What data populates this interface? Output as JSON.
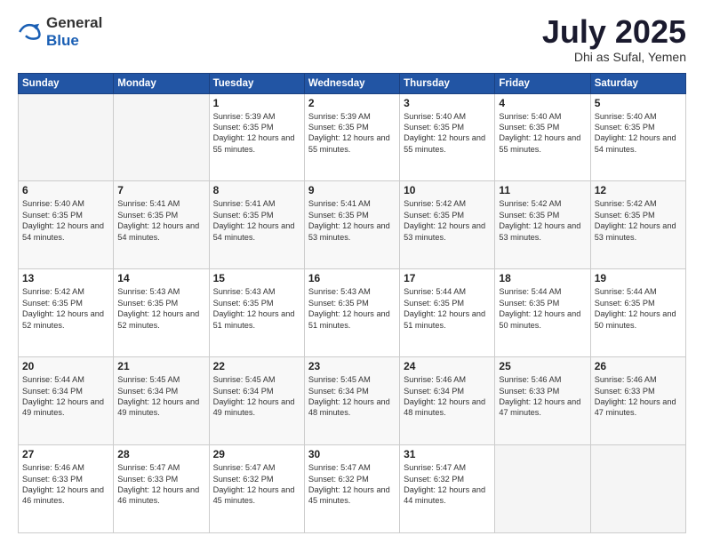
{
  "header": {
    "logo_general": "General",
    "logo_blue": "Blue",
    "month_year": "July 2025",
    "location": "Dhi as Sufal, Yemen"
  },
  "weekdays": [
    "Sunday",
    "Monday",
    "Tuesday",
    "Wednesday",
    "Thursday",
    "Friday",
    "Saturday"
  ],
  "weeks": [
    [
      {
        "day": "",
        "content": ""
      },
      {
        "day": "",
        "content": ""
      },
      {
        "day": "1",
        "content": "Sunrise: 5:39 AM\nSunset: 6:35 PM\nDaylight: 12 hours and 55 minutes."
      },
      {
        "day": "2",
        "content": "Sunrise: 5:39 AM\nSunset: 6:35 PM\nDaylight: 12 hours and 55 minutes."
      },
      {
        "day": "3",
        "content": "Sunrise: 5:40 AM\nSunset: 6:35 PM\nDaylight: 12 hours and 55 minutes."
      },
      {
        "day": "4",
        "content": "Sunrise: 5:40 AM\nSunset: 6:35 PM\nDaylight: 12 hours and 55 minutes."
      },
      {
        "day": "5",
        "content": "Sunrise: 5:40 AM\nSunset: 6:35 PM\nDaylight: 12 hours and 54 minutes."
      }
    ],
    [
      {
        "day": "6",
        "content": "Sunrise: 5:40 AM\nSunset: 6:35 PM\nDaylight: 12 hours and 54 minutes."
      },
      {
        "day": "7",
        "content": "Sunrise: 5:41 AM\nSunset: 6:35 PM\nDaylight: 12 hours and 54 minutes."
      },
      {
        "day": "8",
        "content": "Sunrise: 5:41 AM\nSunset: 6:35 PM\nDaylight: 12 hours and 54 minutes."
      },
      {
        "day": "9",
        "content": "Sunrise: 5:41 AM\nSunset: 6:35 PM\nDaylight: 12 hours and 53 minutes."
      },
      {
        "day": "10",
        "content": "Sunrise: 5:42 AM\nSunset: 6:35 PM\nDaylight: 12 hours and 53 minutes."
      },
      {
        "day": "11",
        "content": "Sunrise: 5:42 AM\nSunset: 6:35 PM\nDaylight: 12 hours and 53 minutes."
      },
      {
        "day": "12",
        "content": "Sunrise: 5:42 AM\nSunset: 6:35 PM\nDaylight: 12 hours and 53 minutes."
      }
    ],
    [
      {
        "day": "13",
        "content": "Sunrise: 5:42 AM\nSunset: 6:35 PM\nDaylight: 12 hours and 52 minutes."
      },
      {
        "day": "14",
        "content": "Sunrise: 5:43 AM\nSunset: 6:35 PM\nDaylight: 12 hours and 52 minutes."
      },
      {
        "day": "15",
        "content": "Sunrise: 5:43 AM\nSunset: 6:35 PM\nDaylight: 12 hours and 51 minutes."
      },
      {
        "day": "16",
        "content": "Sunrise: 5:43 AM\nSunset: 6:35 PM\nDaylight: 12 hours and 51 minutes."
      },
      {
        "day": "17",
        "content": "Sunrise: 5:44 AM\nSunset: 6:35 PM\nDaylight: 12 hours and 51 minutes."
      },
      {
        "day": "18",
        "content": "Sunrise: 5:44 AM\nSunset: 6:35 PM\nDaylight: 12 hours and 50 minutes."
      },
      {
        "day": "19",
        "content": "Sunrise: 5:44 AM\nSunset: 6:35 PM\nDaylight: 12 hours and 50 minutes."
      }
    ],
    [
      {
        "day": "20",
        "content": "Sunrise: 5:44 AM\nSunset: 6:34 PM\nDaylight: 12 hours and 49 minutes."
      },
      {
        "day": "21",
        "content": "Sunrise: 5:45 AM\nSunset: 6:34 PM\nDaylight: 12 hours and 49 minutes."
      },
      {
        "day": "22",
        "content": "Sunrise: 5:45 AM\nSunset: 6:34 PM\nDaylight: 12 hours and 49 minutes."
      },
      {
        "day": "23",
        "content": "Sunrise: 5:45 AM\nSunset: 6:34 PM\nDaylight: 12 hours and 48 minutes."
      },
      {
        "day": "24",
        "content": "Sunrise: 5:46 AM\nSunset: 6:34 PM\nDaylight: 12 hours and 48 minutes."
      },
      {
        "day": "25",
        "content": "Sunrise: 5:46 AM\nSunset: 6:33 PM\nDaylight: 12 hours and 47 minutes."
      },
      {
        "day": "26",
        "content": "Sunrise: 5:46 AM\nSunset: 6:33 PM\nDaylight: 12 hours and 47 minutes."
      }
    ],
    [
      {
        "day": "27",
        "content": "Sunrise: 5:46 AM\nSunset: 6:33 PM\nDaylight: 12 hours and 46 minutes."
      },
      {
        "day": "28",
        "content": "Sunrise: 5:47 AM\nSunset: 6:33 PM\nDaylight: 12 hours and 46 minutes."
      },
      {
        "day": "29",
        "content": "Sunrise: 5:47 AM\nSunset: 6:32 PM\nDaylight: 12 hours and 45 minutes."
      },
      {
        "day": "30",
        "content": "Sunrise: 5:47 AM\nSunset: 6:32 PM\nDaylight: 12 hours and 45 minutes."
      },
      {
        "day": "31",
        "content": "Sunrise: 5:47 AM\nSunset: 6:32 PM\nDaylight: 12 hours and 44 minutes."
      },
      {
        "day": "",
        "content": ""
      },
      {
        "day": "",
        "content": ""
      }
    ]
  ]
}
